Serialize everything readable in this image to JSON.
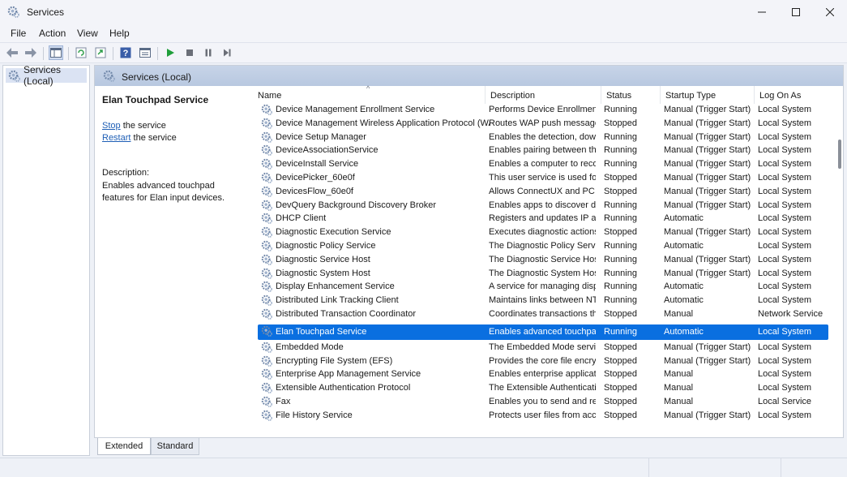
{
  "window": {
    "title": "Services",
    "app_icon": "gear-services-icon"
  },
  "menu": [
    "File",
    "Action",
    "View",
    "Help"
  ],
  "toolbar": {
    "icons": [
      "back-arrow-icon",
      "forward-arrow-icon",
      "show-hide-tree-icon",
      "refresh-icon",
      "export-list-icon",
      "help-icon",
      "properties-icon",
      "start-service-icon",
      "stop-service-icon",
      "pause-service-icon",
      "resume-service-icon"
    ],
    "accent_play": "#1f9e3a"
  },
  "tree": {
    "root_label": "Services (Local)"
  },
  "pane": {
    "header_label": "Services (Local)"
  },
  "detail": {
    "service_name": "Elan Touchpad Service",
    "stop_link": "Stop",
    "stop_suffix": " the service",
    "restart_link": "Restart",
    "restart_suffix": " the service",
    "description_label": "Description:",
    "description_text": "Enables advanced touchpad features for Elan input devices."
  },
  "columns": [
    "Name",
    "Description",
    "Status",
    "Startup Type",
    "Log On As"
  ],
  "sort_indicator": "^",
  "rows": [
    {
      "name": "Device Management Enrollment Service",
      "desc": "Performs Device Enrollment ...",
      "status": "Running",
      "startup": "Manual (Trigger Start)",
      "logon": "Local System"
    },
    {
      "name": "Device Management Wireless Application Protocol (WAP) Push s...",
      "desc": "Routes WAP push messages ...",
      "status": "Stopped",
      "startup": "Manual (Trigger Start)",
      "logon": "Local System"
    },
    {
      "name": "Device Setup Manager",
      "desc": "Enables the detection, downlo...",
      "status": "Running",
      "startup": "Manual (Trigger Start)",
      "logon": "Local System"
    },
    {
      "name": "DeviceAssociationService",
      "desc": "Enables pairing between the s...",
      "status": "Running",
      "startup": "Manual (Trigger Start)",
      "logon": "Local System"
    },
    {
      "name": "DeviceInstall Service",
      "desc": "Enables a computer to recogn...",
      "status": "Running",
      "startup": "Manual (Trigger Start)",
      "logon": "Local System"
    },
    {
      "name": "DevicePicker_60e0f",
      "desc": "This user service is used for pi...",
      "status": "Stopped",
      "startup": "Manual (Trigger Start)",
      "logon": "Local System"
    },
    {
      "name": "DevicesFlow_60e0f",
      "desc": "Allows ConnectUX and PC set...",
      "status": "Stopped",
      "startup": "Manual (Trigger Start)",
      "logon": "Local System"
    },
    {
      "name": "DevQuery Background Discovery Broker",
      "desc": "Enables apps to discover devi...",
      "status": "Running",
      "startup": "Manual (Trigger Start)",
      "logon": "Local System"
    },
    {
      "name": "DHCP Client",
      "desc": "Registers and updates IP addr...",
      "status": "Running",
      "startup": "Automatic",
      "logon": "Local System"
    },
    {
      "name": "Diagnostic Execution Service",
      "desc": "Executes diagnostic actions fo...",
      "status": "Stopped",
      "startup": "Manual (Trigger Start)",
      "logon": "Local System"
    },
    {
      "name": "Diagnostic Policy Service",
      "desc": "The Diagnostic Policy Service ...",
      "status": "Running",
      "startup": "Automatic",
      "logon": "Local System"
    },
    {
      "name": "Diagnostic Service Host",
      "desc": "The Diagnostic Service Host is...",
      "status": "Running",
      "startup": "Manual (Trigger Start)",
      "logon": "Local System"
    },
    {
      "name": "Diagnostic System Host",
      "desc": "The Diagnostic System Host is...",
      "status": "Running",
      "startup": "Manual (Trigger Start)",
      "logon": "Local System"
    },
    {
      "name": "Display Enhancement Service",
      "desc": "A service for managing display...",
      "status": "Running",
      "startup": "Automatic",
      "logon": "Local System"
    },
    {
      "name": "Distributed Link Tracking Client",
      "desc": "Maintains links between NTFS...",
      "status": "Running",
      "startup": "Automatic",
      "logon": "Local System"
    },
    {
      "name": "Distributed Transaction Coordinator",
      "desc": "Coordinates transactions that ...",
      "status": "Stopped",
      "startup": "Manual",
      "logon": "Network Service"
    },
    {
      "name": "Elan Touchpad Service",
      "desc": "Enables advanced touchpad ...",
      "status": "Running",
      "startup": "Automatic",
      "logon": "Local System",
      "selected": true
    },
    {
      "name": "Embedded Mode",
      "desc": "The Embedded Mode service ...",
      "status": "Stopped",
      "startup": "Manual (Trigger Start)",
      "logon": "Local System"
    },
    {
      "name": "Encrypting File System (EFS)",
      "desc": "Provides the core file encrypti...",
      "status": "Stopped",
      "startup": "Manual (Trigger Start)",
      "logon": "Local System"
    },
    {
      "name": "Enterprise App Management Service",
      "desc": "Enables enterprise application...",
      "status": "Stopped",
      "startup": "Manual",
      "logon": "Local System"
    },
    {
      "name": "Extensible Authentication Protocol",
      "desc": "The Extensible Authentication...",
      "status": "Stopped",
      "startup": "Manual",
      "logon": "Local System"
    },
    {
      "name": "Fax",
      "desc": "Enables you to send and recei...",
      "status": "Stopped",
      "startup": "Manual",
      "logon": "Local Service"
    },
    {
      "name": "File History Service",
      "desc": "Protects user files from accide...",
      "status": "Stopped",
      "startup": "Manual (Trigger Start)",
      "logon": "Local System"
    }
  ],
  "tabs": {
    "extended": "Extended",
    "standard": "Standard"
  },
  "colors": {
    "selection": "#0a6fe0",
    "link": "#1f5fb6",
    "header_band": "#c7d4e8"
  }
}
